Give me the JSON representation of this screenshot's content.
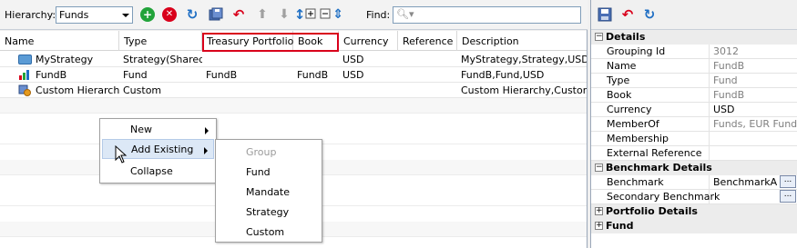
{
  "toolbar": {
    "hierarchy_label": "Hierarchy:",
    "hierarchy_value": "Funds",
    "find_label": "Find:"
  },
  "grid": {
    "columns": [
      "Name",
      "Type",
      "Treasury Portfolio",
      "Book",
      "Currency",
      "Reference",
      "Description"
    ],
    "rows": [
      {
        "name": "MyStrategy",
        "type": "Strategy(Shared)",
        "treasury": "",
        "book": "",
        "currency": "USD",
        "reference": "",
        "description": "MyStrategy,Strategy,USD"
      },
      {
        "name": "FundB",
        "type": "Fund",
        "treasury": "FundB",
        "book": "FundB",
        "currency": "USD",
        "reference": "",
        "description": "FundB,Fund,USD"
      },
      {
        "name": "Custom Hierarchy",
        "type": "Custom",
        "treasury": "",
        "book": "",
        "currency": "",
        "reference": "",
        "description": "Custom Hierarchy,Custom,nu"
      }
    ]
  },
  "context_menu": {
    "items": [
      "New",
      "Add Existing",
      "Collapse"
    ]
  },
  "submenu": {
    "items": [
      "Group",
      "Fund",
      "Mandate",
      "Strategy",
      "Custom"
    ]
  },
  "properties": {
    "details_title": "Details",
    "details": [
      {
        "name": "Grouping Id",
        "value": "3012"
      },
      {
        "name": "Name",
        "value": "FundB"
      },
      {
        "name": "Type",
        "value": "Fund"
      },
      {
        "name": "Book",
        "value": "FundB"
      },
      {
        "name": "Currency",
        "value": "USD"
      },
      {
        "name": "MemberOf",
        "value": "Funds, EUR Funds"
      },
      {
        "name": "Membership",
        "value": ""
      },
      {
        "name": "External Reference",
        "value": ""
      }
    ],
    "benchmark_title": "Benchmark Details",
    "benchmark": [
      {
        "name": "Benchmark",
        "value": "BenchmarkA"
      },
      {
        "name": "Secondary Benchmark",
        "value": ""
      }
    ],
    "portfolio_title": "Portfolio Details",
    "fund_title": "Fund",
    "dots_label": "..."
  },
  "colors": {
    "accent_red": "#d9001b",
    "add_green": "#22a33a",
    "refresh_blue": "#1f6fc4"
  }
}
